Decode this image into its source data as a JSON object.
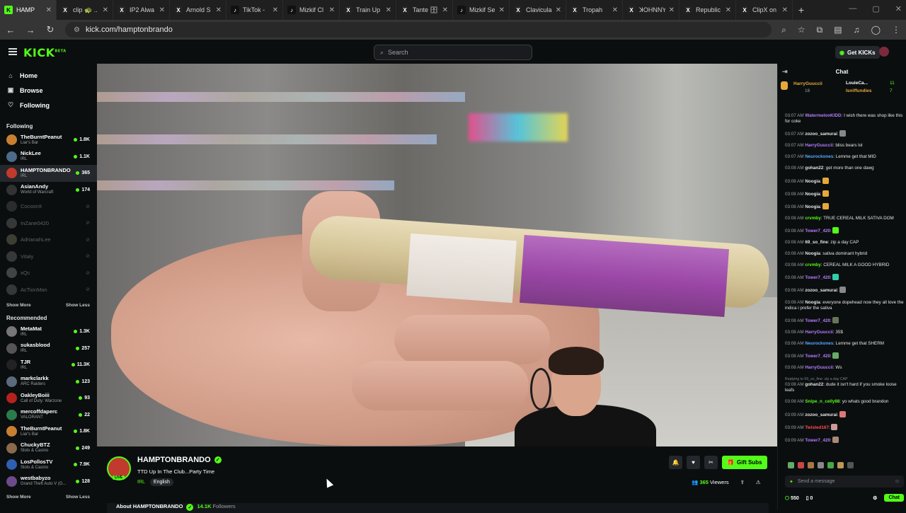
{
  "browser": {
    "tabs": [
      {
        "title": "HAMP",
        "color": "#53fc18",
        "glyph": "K",
        "active": true
      },
      {
        "title": "clip 🐢 ..",
        "color": "#222",
        "glyph": "X"
      },
      {
        "title": "IP2 Alwa",
        "color": "#222",
        "glyph": "X"
      },
      {
        "title": "Arnold S",
        "color": "#222",
        "glyph": "X"
      },
      {
        "title": "TikTok - ",
        "color": "#111",
        "glyph": "♪"
      },
      {
        "title": "Mizkif Cl",
        "color": "#111",
        "glyph": "♪"
      },
      {
        "title": "Train Up",
        "color": "#222",
        "glyph": "X"
      },
      {
        "title": "Tante 🗄",
        "color": "#222",
        "glyph": "X"
      },
      {
        "title": "Mizkif Se",
        "color": "#111",
        "glyph": "♪"
      },
      {
        "title": "Clavicula",
        "color": "#222",
        "glyph": "X"
      },
      {
        "title": "Tropah",
        "color": "#222",
        "glyph": "X"
      },
      {
        "title": "ꓘOHNNY",
        "color": "#222",
        "glyph": "X"
      },
      {
        "title": "Republic",
        "color": "#222",
        "glyph": "X"
      },
      {
        "title": "ClipX on",
        "color": "#222",
        "glyph": "X"
      }
    ],
    "url": "kick.com/hamptonbrando"
  },
  "header": {
    "logo": "KICK",
    "logo_sup": "BETA",
    "search_placeholder": "Search",
    "get_kicks": "Get KICKs"
  },
  "sidebar": {
    "nav": [
      {
        "label": "Home",
        "icon": "home-icon",
        "glyph": "⌂"
      },
      {
        "label": "Browse",
        "icon": "browse-icon",
        "glyph": "▣"
      },
      {
        "label": "Following",
        "icon": "heart-icon",
        "glyph": "♡"
      }
    ],
    "following_title": "Following",
    "following": [
      {
        "name": "TheBurntPeanut",
        "category": "Liar's Bar",
        "viewers": "1.8K",
        "color": "#c97f30"
      },
      {
        "name": "NickLee",
        "category": "IRL",
        "viewers": "1.1K",
        "color": "#4d6a8a"
      },
      {
        "name": "HAMPTONBRANDO",
        "category": "IRL",
        "viewers": "365",
        "color": "#c23a2d",
        "selected": true
      },
      {
        "name": "AsianAndy",
        "category": "World of Warcraft",
        "viewers": "174",
        "color": "#333"
      },
      {
        "name": "CocoonIt",
        "offline": true,
        "color": "#666"
      },
      {
        "name": "InZane0420",
        "offline": true,
        "color": "#888"
      },
      {
        "name": "AdrianahLee",
        "offline": true,
        "color": "#997"
      },
      {
        "name": "Vitaly",
        "offline": true,
        "color": "#888"
      },
      {
        "name": "xQc",
        "offline": true,
        "color": "#aaa"
      },
      {
        "name": "AcTionMan",
        "offline": true,
        "color": "#888"
      }
    ],
    "show_more": "Show More",
    "show_less": "Show Less",
    "recommended_title": "Recommended",
    "recommended": [
      {
        "name": "MetaMat",
        "category": "IRL",
        "viewers": "1.3K",
        "color": "#777"
      },
      {
        "name": "sukasblood",
        "category": "IRL",
        "viewers": "257",
        "color": "#555"
      },
      {
        "name": "TJR",
        "category": "IRL",
        "viewers": "11.3K",
        "color": "#222"
      },
      {
        "name": "markclarkk",
        "category": "ARC Raiders",
        "viewers": "123",
        "color": "#5a6b7c"
      },
      {
        "name": "OakleyBoiii",
        "category": "Call of Duty: Warzone",
        "viewers": "93",
        "color": "#b3221c"
      },
      {
        "name": "mercoffdaperc",
        "category": "VALORANT",
        "viewers": "22",
        "color": "#2b7a4b"
      },
      {
        "name": "TheBurntPeanut",
        "category": "Liar's Bar",
        "viewers": "1.8K",
        "color": "#c97f30"
      },
      {
        "name": "ChuckyBTZ",
        "category": "Slots & Casino",
        "viewers": "249",
        "color": "#8a6a4a"
      },
      {
        "name": "LosPollosTV",
        "category": "Slots & Casino",
        "viewers": "7.9K",
        "color": "#2e5fb0"
      },
      {
        "name": "westbabyzo",
        "category": "Grand Theft Auto V (G...",
        "viewers": "128",
        "color": "#6d4a8a"
      }
    ]
  },
  "stream": {
    "streamer": "HAMPTONBRANDO",
    "title": "TTD Up In The Club...Party Time",
    "category": "IRL",
    "language": "English",
    "live_label": "LIVE",
    "gift_subs": "Gift Subs",
    "viewers": "365",
    "viewers_label": "Viewers",
    "about_label": "About HAMPTONBRANDO",
    "followers": "14.1K",
    "followers_label": "Followers"
  },
  "chat": {
    "title": "Chat",
    "pinned": [
      {
        "name": "HarryGuuccii",
        "count": "16"
      },
      {
        "name": "LouieCa...",
        "count": "11"
      },
      {
        "name": "Isniffundies",
        "count": "7"
      }
    ],
    "messages": [
      {
        "ts": "03:07 AM",
        "user": "WatermelonKIDD",
        "color": "#b57bff",
        "text": "I wish there was shop like this for coke"
      },
      {
        "ts": "03:07 AM",
        "user": "zozoo_samurai",
        "color": "#e6e6e6",
        "text": "",
        "emote": "#888"
      },
      {
        "ts": "03:07 AM",
        "user": "HarryGuuccii",
        "color": "#b57bff",
        "text": "bliss bears lol"
      },
      {
        "ts": "03:07 AM",
        "user": "Neurockones",
        "color": "#56a8ff",
        "text": "Lemme get that MID"
      },
      {
        "ts": "03:08 AM",
        "user": "gohan22",
        "color": "#e6e6e6",
        "text": "get more than one dawg"
      },
      {
        "ts": "03:08 AM",
        "user": "Noogia",
        "color": "#e6e6e6",
        "text": "",
        "emote": "#e5a83b"
      },
      {
        "ts": "03:08 AM",
        "user": "Noogia",
        "color": "#e6e6e6",
        "text": "",
        "emote": "#e5a83b"
      },
      {
        "ts": "03:08 AM",
        "user": "Noogia",
        "color": "#e6e6e6",
        "text": "",
        "emote": "#e5a83b"
      },
      {
        "ts": "03:08 AM",
        "user": "crvmby",
        "color": "#53fc18",
        "text": "TRUE CEREAL MILK SATIVA DOM"
      },
      {
        "ts": "03:08 AM",
        "user": "Tower7_420",
        "color": "#b57bff",
        "text": "",
        "emote": "#53fc18"
      },
      {
        "ts": "03:08 AM",
        "user": "69_so_fine",
        "color": "#e6e6e6",
        "text": "zip a day CAP"
      },
      {
        "ts": "03:08 AM",
        "user": "Noogia",
        "color": "#e6e6e6",
        "text": "sativa dominant hybrid"
      },
      {
        "ts": "03:08 AM",
        "user": "crvmby",
        "color": "#53fc18",
        "text": "CEREAL MILK A GOOD HYBRID"
      },
      {
        "ts": "03:08 AM",
        "user": "Tower7_420",
        "color": "#b57bff",
        "text": "",
        "emote": "#3ca"
      },
      {
        "ts": "03:08 AM",
        "user": "zozoo_samurai",
        "color": "#e6e6e6",
        "text": "",
        "emote": "#888"
      },
      {
        "ts": "03:08 AM",
        "user": "Noogia",
        "color": "#e6e6e6",
        "text": "everyone dopehead now they all love the indica i prefer the sativa"
      },
      {
        "ts": "03:08 AM",
        "user": "Tower7_420",
        "color": "#b57bff",
        "text": "",
        "emote": "#675"
      },
      {
        "ts": "03:08 AM",
        "user": "HarryGuuccii",
        "color": "#b57bff",
        "text": "35$"
      },
      {
        "ts": "03:08 AM",
        "user": "Neurockones",
        "color": "#56a8ff",
        "text": "Lemme get that SHERM"
      },
      {
        "ts": "03:08 AM",
        "user": "Tower7_420",
        "color": "#b57bff",
        "text": "",
        "emote": "#6a6"
      },
      {
        "ts": "03:08 AM",
        "user": "HarryGuuccii",
        "color": "#b57bff",
        "text": "Ws"
      },
      {
        "reply": "Replying to 69_so_fine: zip a day CAP",
        "ts": "03:08 AM",
        "user": "gohan22",
        "color": "#e6e6e6",
        "text": "dude it isn't hard if you smoke loose leafs"
      },
      {
        "ts": "03:08 AM",
        "user": "Snipe_n_celly88",
        "color": "#53fc18",
        "text": "yo whats good brandon"
      },
      {
        "ts": "03:09 AM",
        "user": "zozoo_samurai",
        "color": "#e6e6e6",
        "text": "",
        "emote": "#d77"
      },
      {
        "ts": "03:09 AM",
        "user": "Twisted167",
        "color": "#ff4d4d",
        "text": "",
        "emote": "#c99"
      },
      {
        "ts": "03:09 AM",
        "user": "Tower7_420",
        "color": "#b57bff",
        "text": "",
        "emote": "#a87"
      }
    ],
    "send_placeholder": "Send a message",
    "points": "550",
    "sub_count": "0",
    "chat_button": "Chat"
  }
}
